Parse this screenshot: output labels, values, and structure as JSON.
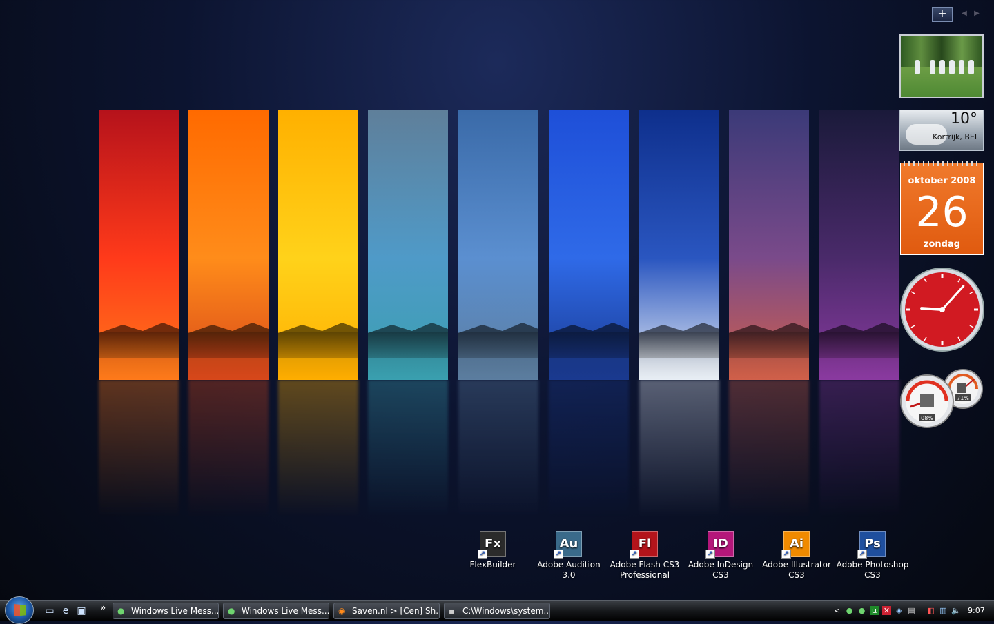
{
  "desktop_icons": [
    {
      "abbr": "Fx",
      "label": "FlexBuilder",
      "color": "#2b2b2b"
    },
    {
      "abbr": "Au",
      "label": "Adobe Audition 3.0",
      "color": "#3a6a8a"
    },
    {
      "abbr": "Fl",
      "label": "Adobe Flash CS3 Professional",
      "color": "#b3141b"
    },
    {
      "abbr": "ID",
      "label": "Adobe InDesign CS3",
      "color": "#b4177a"
    },
    {
      "abbr": "Ai",
      "label": "Adobe Illustrator CS3",
      "color": "#f08a00"
    },
    {
      "abbr": "Ps",
      "label": "Adobe Photoshop CS3",
      "color": "#1f4f9e"
    }
  ],
  "sidebar": {
    "add_gadget": "+",
    "weather": {
      "temp": "10°",
      "location": "Kortrijk, BEL"
    },
    "calendar": {
      "month": "oktober 2008",
      "day": "26",
      "weekday": "zondag"
    },
    "clock": {
      "hour": 9,
      "minute": 7
    },
    "meter": {
      "cpu": "08%",
      "memory": "71%"
    }
  },
  "taskbar": {
    "quicklaunch_more": "»",
    "buttons": [
      {
        "label": "Windows Live Mess...",
        "icon": "messenger-icon"
      },
      {
        "label": "Windows Live Mess...",
        "icon": "messenger-icon"
      },
      {
        "label": "Saven.nl > [Cen] Sh...",
        "icon": "firefox-icon"
      },
      {
        "label": "C:\\Windows\\system...",
        "icon": "cmd-icon"
      }
    ],
    "tray_expand": "<",
    "time": "9:07"
  },
  "strips": [
    {
      "top": "#b5121b",
      "mid": "#ff3a1a",
      "bot": "#ff7a1a"
    },
    {
      "top": "#ff6a00",
      "mid": "#ff8c1a",
      "bot": "#d8481a"
    },
    {
      "top": "#ffb000",
      "mid": "#ffd21a",
      "bot": "#ffae00"
    },
    {
      "top": "#5f7f9a",
      "mid": "#4f9ac8",
      "bot": "#3aa0b0"
    },
    {
      "top": "#3a6aa8",
      "mid": "#5b8fd0",
      "bot": "#5c7ea0"
    },
    {
      "top": "#1e4fd8",
      "mid": "#2f6ae8",
      "bot": "#1a3a90"
    },
    {
      "top": "#0e2f8c",
      "mid": "#2a56c0",
      "bot": "#e8eef5"
    },
    {
      "top": "#3b3a78",
      "mid": "#7a4a8a",
      "bot": "#d0604a"
    },
    {
      "top": "#1a1a3a",
      "mid": "#4a2a6a",
      "bot": "#8a3aa0"
    }
  ]
}
